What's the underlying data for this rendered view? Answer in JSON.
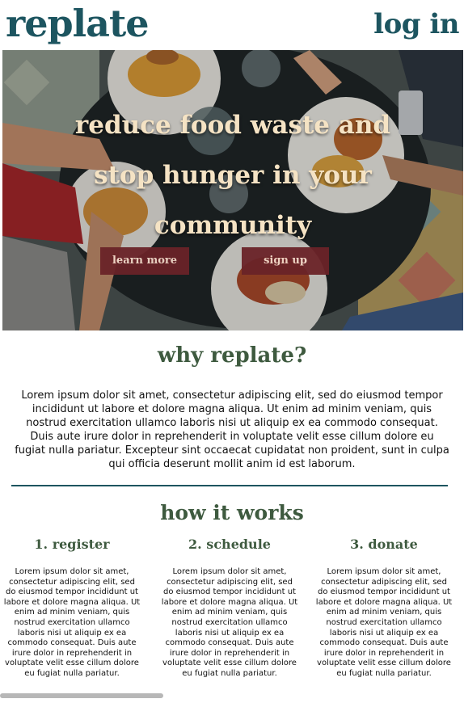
{
  "header": {
    "logo": "replate",
    "login_label": "log in"
  },
  "hero": {
    "title": "reduce food waste and stop hunger in your community",
    "learn_more_label": "learn more",
    "sign_up_label": "sign up"
  },
  "why": {
    "title": "why replate?",
    "text": "Lorem ipsum dolor sit amet, consectetur adipiscing elit, sed do eiusmod tempor incididunt ut labore et dolore magna aliqua. Ut enim ad minim veniam, quis nostrud exercitation ullamco laboris nisi ut aliquip ex ea commodo consequat. Duis aute irure dolor in reprehenderit in voluptate velit esse cillum dolore eu fugiat nulla pariatur. Excepteur sint occaecat cupidatat non proident, sunt in culpa qui officia deserunt mollit anim id est laborum."
  },
  "how": {
    "title": "how it works",
    "steps": [
      {
        "title": "1. register",
        "text": "Lorem ipsum dolor sit amet, consectetur adipiscing elit, sed do eiusmod tempor incididunt ut labore et dolore magna aliqua. Ut enim ad minim veniam, quis nostrud exercitation ullamco laboris nisi ut aliquip ex ea commodo consequat. Duis aute irure dolor in reprehenderit in voluptate velit esse cillum dolore eu fugiat nulla pariatur."
      },
      {
        "title": "2. schedule",
        "text": "Lorem ipsum dolor sit amet, consectetur adipiscing elit, sed do eiusmod tempor incididunt ut labore et dolore magna aliqua. Ut enim ad minim veniam, quis nostrud exercitation ullamco laboris nisi ut aliquip ex ea commodo consequat. Duis aute irure dolor in reprehenderit in voluptate velit esse cillum dolore eu fugiat nulla pariatur."
      },
      {
        "title": "3. donate",
        "text": "Lorem ipsum dolor sit amet, consectetur adipiscing elit, sed do eiusmod tempor incididunt ut labore et dolore magna aliqua. Ut enim ad minim veniam, quis nostrud exercitation ullamco laboris nisi ut aliquip ex ea commodo consequat. Duis aute irure dolor in reprehenderit in voluptate velit esse cillum dolore eu fugiat nulla pariatur."
      }
    ]
  },
  "colors": {
    "brand": "#1d5560",
    "heading_green": "#3e5a3f",
    "button_bg": "#6a2328",
    "hero_text": "#f5e3c4"
  }
}
